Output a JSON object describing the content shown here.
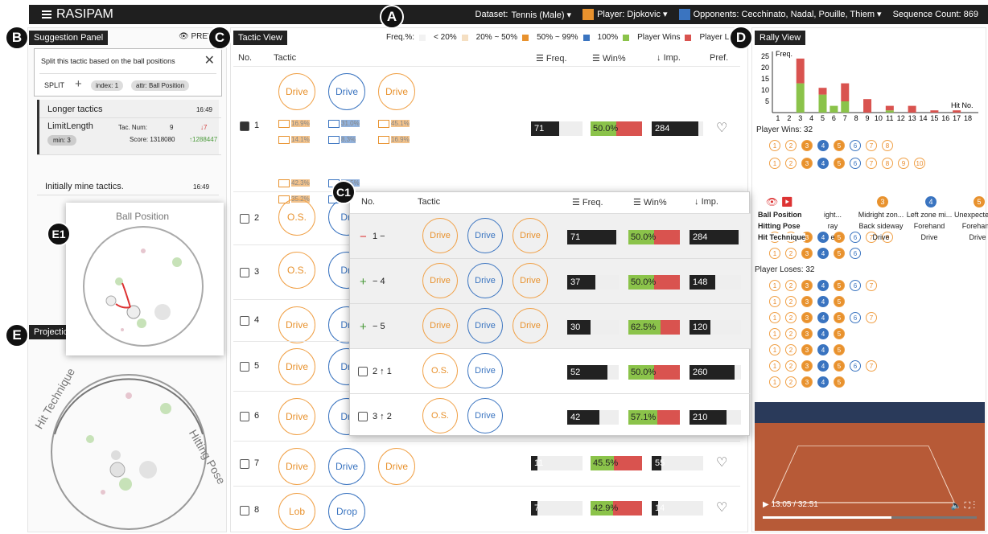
{
  "app": {
    "title": "RASIPAM"
  },
  "topbar": {
    "dataset_label": "Dataset:",
    "dataset_value": "Tennis (Male) ▾",
    "player_label": "Player:",
    "player_value": "Djokovic ▾",
    "opp_label": "Opponents:",
    "opp_value": "Cecchinato, Nadal, Pouille, Thiem ▾",
    "seqcount": "Sequence Count: 869",
    "player_color": "#e8922e",
    "opp_color": "#3a74c0"
  },
  "badges": {
    "a": "A",
    "b": "B",
    "c": "C",
    "c1": "C1",
    "d": "D",
    "e": "E",
    "e1": "E1"
  },
  "suggestion": {
    "tag": "Suggestion Panel",
    "preview": "PREV",
    "query": "Split this tactic based on the ball positions",
    "split": "SPLIT",
    "chip1": "index: 1",
    "chip2": "attr: Ball Position",
    "h1": "Longer tactics",
    "t1": "16:49",
    "h2": "LimitLength",
    "tacnum_label": "Tac. Num:",
    "tacnum": "9",
    "tacnum_delta": "↓7",
    "min": "min: 3",
    "score_label": "Score: 1318080",
    "score_delta": "↑1288447",
    "h3": "Initially mine tactics.",
    "t3": "16:49"
  },
  "tactic": {
    "tag": "Tactic View",
    "legend_freq": "Freq.%:",
    "l1": "< 20%",
    "l2": "20% ~ 50%",
    "l3": "50% ~ 99%",
    "l4": "100%",
    "lw": "Player Wins",
    "ll": "Player Lo",
    "headers": {
      "no": "No.",
      "tactic": "Tactic",
      "freq": "Freq.",
      "win": "Win%",
      "imp": "Imp.",
      "pref": "Pref."
    },
    "rows": [
      {
        "no": "1",
        "freq": "71",
        "freqpct": 0.55,
        "win": "50.0%",
        "winpct": 0.5,
        "imp": "284",
        "imppct": 0.9,
        "c": [
          "Drive",
          "Drive",
          "Drive"
        ],
        "ck": true
      },
      {
        "no": "2",
        "c": [
          "O.S.",
          "Dri"
        ]
      },
      {
        "no": "3",
        "c": [
          "O.S.",
          "Dri"
        ]
      },
      {
        "no": "4",
        "c": [
          "Drive",
          "Dri"
        ]
      },
      {
        "no": "5",
        "c": [
          "Drive",
          "Dri"
        ]
      },
      {
        "no": "6",
        "c": [
          "Drive",
          "Dri"
        ]
      },
      {
        "no": "7",
        "freq": "11",
        "freqpct": 0.08,
        "win": "45.5%",
        "winpct": 0.45,
        "imp": "55",
        "imppct": 0.18,
        "c": [
          "Drive",
          "Drive",
          "Drive"
        ]
      },
      {
        "no": "8",
        "freq": "7",
        "freqpct": 0.05,
        "win": "42.9%",
        "winpct": 0.43,
        "imp": "14",
        "imppct": 0.05,
        "c": [
          "Lob",
          "Drop",
          ""
        ]
      }
    ],
    "r1stats": [
      "16.9%",
      "31.0%",
      "45.1%",
      "14.1%",
      "8.3%",
      "16.9%",
      "42.3%",
      "53.5%",
      "35.2%",
      "32.2%"
    ]
  },
  "popup": {
    "no": "No.",
    "tactic": "Tactic",
    "freq": "Freq.",
    "win": "Win%",
    "imp": "Imp.",
    "rows": [
      {
        "sign": "−",
        "label": "1 −",
        "c": [
          "Drive",
          "Drive",
          "Drive"
        ],
        "freq": "71",
        "fp": 0.95,
        "win": "50.0%",
        "wp": 0.5,
        "imp": "284",
        "ip": 0.95
      },
      {
        "sign": "+",
        "label": "− 4",
        "c": [
          "Drive",
          "Drive",
          "Drive"
        ],
        "freq": "37",
        "fp": 0.55,
        "win": "50.0%",
        "wp": 0.5,
        "imp": "148",
        "ip": 0.5
      },
      {
        "sign": "+",
        "label": "− 5",
        "c": [
          "Drive",
          "Drive",
          "Drive"
        ],
        "freq": "30",
        "fp": 0.45,
        "win": "62.5%",
        "wp": 0.62,
        "imp": "120",
        "ip": 0.4
      },
      {
        "sign": "",
        "label": "2 ↑ 1",
        "c": [
          "O.S.",
          "Drive"
        ],
        "freq": "52",
        "fp": 0.78,
        "win": "50.0%",
        "wp": 0.5,
        "imp": "260",
        "ip": 0.88
      },
      {
        "sign": "",
        "label": "3 ↑ 2",
        "c": [
          "O.S.",
          "Drive"
        ],
        "freq": "42",
        "fp": 0.62,
        "win": "57.1%",
        "wp": 0.57,
        "imp": "210",
        "ip": 0.72
      }
    ]
  },
  "rally": {
    "tag": "Rally View",
    "freq_axis": "Freq.",
    "hit_axis": "Hit No.",
    "yticks": [
      "25",
      "20",
      "15",
      "10",
      "5"
    ],
    "xticks": [
      "1",
      "2",
      "3",
      "4",
      "5",
      "6",
      "7",
      "8",
      "9",
      "10",
      "11",
      "12",
      "13",
      "14",
      "15",
      "16",
      "17",
      "18"
    ],
    "green": [
      0,
      0,
      13,
      0,
      8,
      3,
      5,
      0,
      0,
      0,
      1,
      0,
      0,
      0,
      0,
      0,
      0,
      0
    ],
    "red": [
      0,
      0,
      11,
      0,
      3,
      0,
      8,
      0,
      6,
      0,
      2,
      0,
      3,
      0,
      1,
      0,
      1,
      0
    ],
    "wins": "Player Wins: 32",
    "loses": "Player Loses: 32",
    "tbl_labels": [
      "Ball Position",
      "Hitting Pose",
      "Hit Technique"
    ],
    "tbl_cols": [
      {
        "n": "",
        "a": "ight...",
        "b": "ray",
        "c": "e"
      },
      {
        "n": "3",
        "a": "Midright zon...",
        "b": "Back sideway",
        "c": "Drive"
      },
      {
        "n": "4",
        "a": "Left zone mi...",
        "b": "Forehand",
        "c": "Drive"
      },
      {
        "n": "5",
        "a": "Unexpected ...",
        "b": "Forehand",
        "c": "Drive"
      }
    ],
    "video_time": "13:05 / 32:51"
  },
  "projection": {
    "tag": "Projection",
    "top": "Ball Position",
    "left": "Hit Technique",
    "right": "Hitting Pose"
  }
}
